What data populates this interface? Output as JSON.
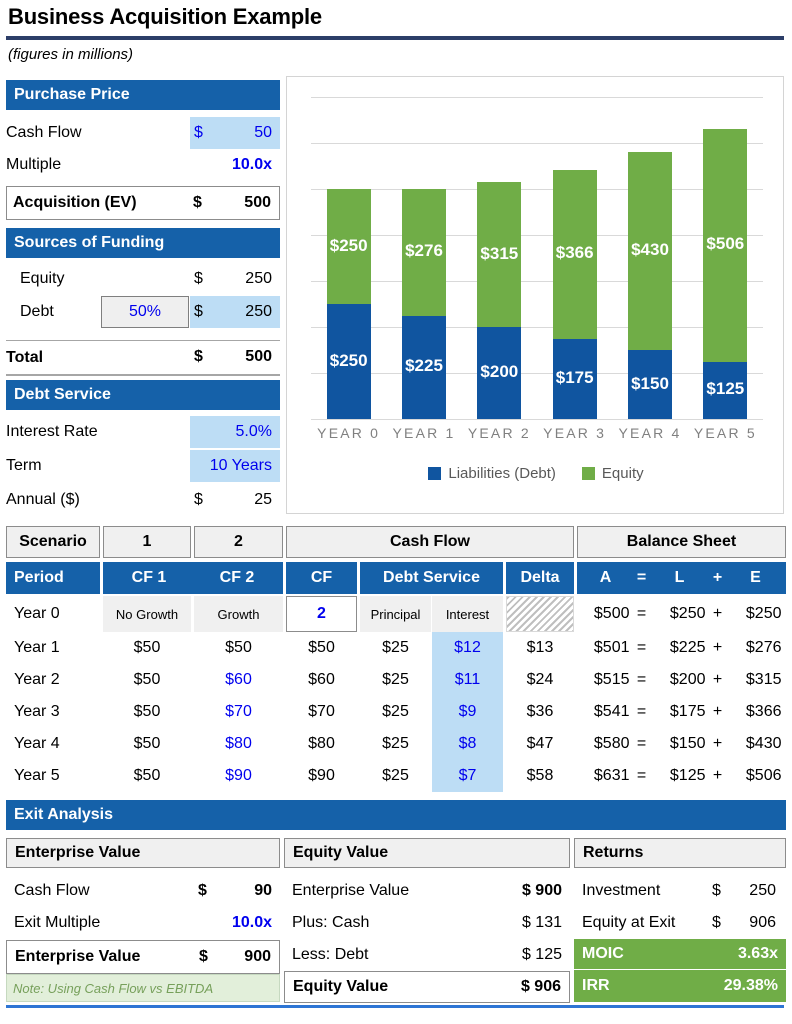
{
  "title": "Business Acquisition Example",
  "subtitle": "(figures in millions)",
  "colors": {
    "header_blue": "#1561A9",
    "title_rule": "#2C3E68",
    "input_highlight": "#BDDDF5",
    "input_text": "#0000EE",
    "bar_debt": "#1055A0",
    "bar_equity": "#70AD47",
    "returns_green": "#70AD47",
    "note_green_bg": "#E2EFDA",
    "bottom_rule": "#2E75D4"
  },
  "purchase_price": {
    "header": "Purchase Price",
    "rows": [
      {
        "label": "Cash Flow",
        "currency": "$",
        "value": "50",
        "highlight": true
      },
      {
        "label": "Multiple",
        "currency": "",
        "value": "10.0x",
        "highlight": false
      }
    ],
    "total": {
      "label": "Acquisition (EV)",
      "currency": "$",
      "value": "500"
    }
  },
  "sources_of_funding": {
    "header": "Sources of Funding",
    "rows": [
      {
        "label": "Equity",
        "pct": "",
        "currency": "$",
        "value": "250",
        "highlight": false
      },
      {
        "label": "Debt",
        "pct": "50%",
        "currency": "$",
        "value": "250",
        "highlight": true
      }
    ],
    "total": {
      "label": "Total",
      "currency": "$",
      "value": "500"
    }
  },
  "debt_service": {
    "header": "Debt Service",
    "rows": [
      {
        "label": "Interest Rate",
        "currency": "",
        "value": "5.0%",
        "highlight": true
      },
      {
        "label": "Term",
        "currency": "",
        "value": "10 Years",
        "highlight": true
      },
      {
        "label": "Annual ($)",
        "currency": "$",
        "value": "25",
        "highlight": false
      }
    ]
  },
  "chart_data": {
    "type": "bar",
    "subtype": "stacked-column",
    "title": "",
    "xlabel": "",
    "ylabel": "",
    "categories": [
      "YEAR 0",
      "YEAR 1",
      "YEAR 2",
      "YEAR 3",
      "YEAR 4",
      "YEAR 5"
    ],
    "series": [
      {
        "name": "Liabilities (Debt)",
        "color": "#1055A0",
        "values": [
          250,
          225,
          200,
          175,
          150,
          125
        ],
        "labels": [
          "$250",
          "$225",
          "$200",
          "$175",
          "$150",
          "$125"
        ]
      },
      {
        "name": "Equity",
        "color": "#70AD47",
        "values": [
          250,
          276,
          315,
          366,
          430,
          506
        ],
        "labels": [
          "$250",
          "$276",
          "$315",
          "$366",
          "$430",
          "$506"
        ]
      }
    ],
    "totals": [
      500,
      501,
      515,
      541,
      580,
      631
    ],
    "ylim": [
      0,
      700
    ],
    "grid": true,
    "gridlines": [
      0,
      100,
      200,
      300,
      400,
      500,
      600,
      700
    ],
    "legend_position": "bottom"
  },
  "main_table": {
    "group_headers": [
      {
        "label": "Scenario"
      },
      {
        "label": "1"
      },
      {
        "label": "2"
      },
      {
        "label": "Cash Flow"
      },
      {
        "label": "Balance Sheet"
      }
    ],
    "column_headers": [
      "Period",
      "CF 1",
      "CF 2",
      "CF",
      "Debt Service",
      "Delta",
      "A",
      "=",
      "L",
      "+",
      "E"
    ],
    "subheader_row": {
      "period": "Year 0",
      "cf1": "No Growth",
      "cf2": "Growth",
      "cf": "2",
      "principal": "Principal",
      "interest": "Interest",
      "delta": "",
      "a": "$500",
      "eq1": "=",
      "l": "$250",
      "plus": "+",
      "e": "$250"
    },
    "rows": [
      {
        "period": "Year 1",
        "cf1": "$50",
        "cf2": "$50",
        "cf2_blue": false,
        "cf": "$50",
        "principal": "$25",
        "interest": "$12",
        "delta": "$13",
        "a": "$501",
        "eq1": "=",
        "l": "$225",
        "plus": "+",
        "e": "$276"
      },
      {
        "period": "Year 2",
        "cf1": "$50",
        "cf2": "$60",
        "cf2_blue": true,
        "cf": "$60",
        "principal": "$25",
        "interest": "$11",
        "delta": "$24",
        "a": "$515",
        "eq1": "=",
        "l": "$200",
        "plus": "+",
        "e": "$315"
      },
      {
        "period": "Year 3",
        "cf1": "$50",
        "cf2": "$70",
        "cf2_blue": true,
        "cf": "$70",
        "principal": "$25",
        "interest": "$9",
        "delta": "$36",
        "a": "$541",
        "eq1": "=",
        "l": "$175",
        "plus": "+",
        "e": "$366"
      },
      {
        "period": "Year 4",
        "cf1": "$50",
        "cf2": "$80",
        "cf2_blue": true,
        "cf": "$80",
        "principal": "$25",
        "interest": "$8",
        "delta": "$47",
        "a": "$580",
        "eq1": "=",
        "l": "$150",
        "plus": "+",
        "e": "$430"
      },
      {
        "period": "Year 5",
        "cf1": "$50",
        "cf2": "$90",
        "cf2_blue": true,
        "cf": "$90",
        "principal": "$25",
        "interest": "$7",
        "delta": "$58",
        "a": "$631",
        "eq1": "=",
        "l": "$125",
        "plus": "+",
        "e": "$506"
      }
    ]
  },
  "exit_analysis": {
    "header": "Exit Analysis",
    "enterprise_value": {
      "title": "Enterprise Value",
      "rows": [
        {
          "label": "Cash Flow",
          "currency": "$",
          "value": "90",
          "blue": false
        },
        {
          "label": "Exit Multiple",
          "currency": "",
          "value": "10.0x",
          "blue": true
        }
      ],
      "total": {
        "label": "Enterprise Value",
        "currency": "$",
        "value": "900"
      },
      "note": "Note: Using Cash Flow vs EBITDA"
    },
    "equity_value": {
      "title": "Equity Value",
      "rows": [
        {
          "label": "Enterprise Value",
          "value": "$ 900",
          "bold": true
        },
        {
          "label": "Plus: Cash",
          "value": "$ 131",
          "bold": false
        },
        {
          "label": "Less: Debt",
          "value": "$ 125",
          "bold": false
        }
      ],
      "total": {
        "label": "Equity Value",
        "value": "$ 906"
      }
    },
    "returns": {
      "title": "Returns",
      "rows": [
        {
          "label": "Investment",
          "currency": "$",
          "value": "250"
        },
        {
          "label": "Equity at Exit",
          "currency": "$",
          "value": "906"
        }
      ],
      "highlights": [
        {
          "label": "MOIC",
          "value": "3.63x"
        },
        {
          "label": "IRR",
          "value": "29.38%"
        }
      ]
    }
  }
}
